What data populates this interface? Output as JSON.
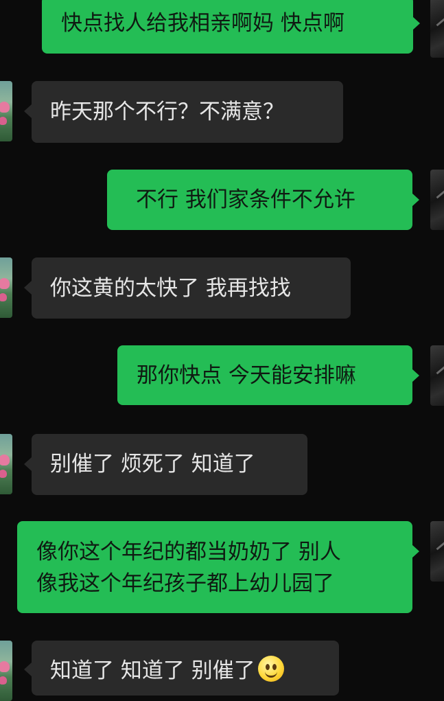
{
  "messages": [
    {
      "side": "me",
      "text": "快点找人给我相亲啊妈 快点啊"
    },
    {
      "side": "other",
      "text": "昨天那个不行？不满意？"
    },
    {
      "side": "me",
      "text": "不行 我们家条件不允许"
    },
    {
      "side": "other",
      "text": "你这黄的太快了 我再找找"
    },
    {
      "side": "me",
      "text": "那你快点 今天能安排嘛"
    },
    {
      "side": "other",
      "text": "别催了 烦死了 知道了"
    },
    {
      "side": "me",
      "line1": "像你这个年纪的都当奶奶了 别人",
      "line2": "像我这个年纪孩子都上幼儿园了"
    },
    {
      "side": "other",
      "text": "知道了 知道了 别催了",
      "emoji": "smiling-face-emoji"
    }
  ],
  "colors": {
    "background": "#0b0b0b",
    "my_bubble": "#24bd55",
    "their_bubble": "#2a2a2a"
  }
}
